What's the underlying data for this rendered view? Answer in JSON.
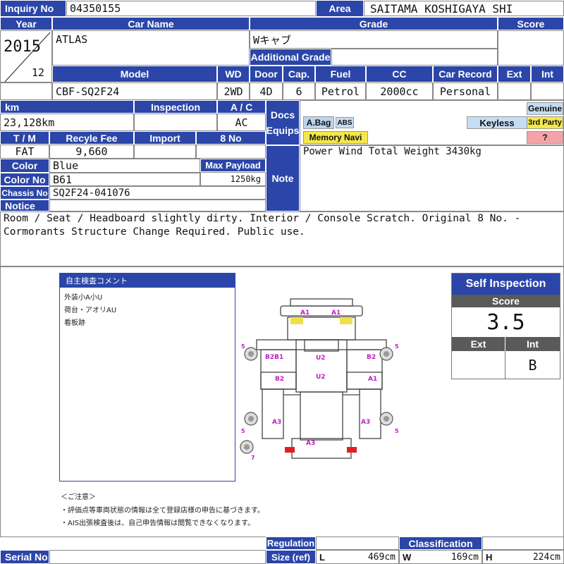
{
  "top": {
    "inquiry_label": "Inquiry No",
    "inquiry_value": "04350155",
    "area_label": "Area",
    "area_value": "SAITAMA KOSHIGAYA SHI"
  },
  "headers": {
    "year": "Year",
    "car_name": "Car Name",
    "grade": "Grade",
    "score": "Score",
    "additional_grade": "Additional Grade",
    "model": "Model",
    "wd": "WD",
    "door": "Door",
    "cap": "Cap.",
    "fuel": "Fuel",
    "cc": "CC",
    "car_record": "Car Record",
    "ext": "Ext",
    "int": "Int",
    "km": "km",
    "inspection": "Inspection",
    "ac": "A / C",
    "docs_equips": "Docs Equips",
    "tm": "T / M",
    "recycle_fee": "Recyle Fee",
    "import": "Import",
    "eight_no": "8 No",
    "color": "Color",
    "max_payload": "Max Payload",
    "color_no": "Color No",
    "chassis_no": "Chassis No",
    "note": "Note",
    "notice": "Notice"
  },
  "vehicle": {
    "year": "2015",
    "month": "12",
    "car_name": "ATLAS",
    "grade": "Wキャブ",
    "additional_grade": "",
    "model": "CBF-SQ2F24",
    "wd": "2WD",
    "door": "4D",
    "cap": "6",
    "fuel": "Petrol",
    "cc": "2000cc",
    "car_record": "Personal",
    "ext": "",
    "int": "",
    "km": "23,128km",
    "inspection": "",
    "ac": "AC",
    "tm": "FAT",
    "recycle_fee": "9,660",
    "import": "",
    "eight_no": "",
    "color": "Blue",
    "max_payload": "1250kg",
    "color_no": "B61",
    "chassis_no": "SQ2F24-041076"
  },
  "equips": {
    "abag": "A.Bag",
    "abs": "ABS",
    "memory_navi": "Memory Navi",
    "keyless": "Keyless",
    "genuine": "Genuine",
    "third_party": "3rd Party",
    "question": "?"
  },
  "note_text": "Power Wind Total Weight 3430kg",
  "notice_text": "Room / Seat / Headboard slightly dirty. Interior / Console Scratch. Original 8 No. - Cormorants Structure Change Required. Public use.",
  "comment_box": {
    "title": "自主検査コメント",
    "lines": [
      "外装小A小U",
      "荷台・アオリAU",
      "看板跡"
    ]
  },
  "diagram": {
    "labels": [
      "A1",
      "A1",
      "B2B1",
      "U2",
      "B2",
      "B2",
      "U2",
      "A1",
      "A3",
      "A3",
      "A3"
    ],
    "tire_numbers": [
      "5",
      "5",
      "5",
      "5",
      "7"
    ]
  },
  "self_inspection": {
    "title": "Self Inspection",
    "score_label": "Score",
    "score_value": "3.5",
    "ext_label": "Ext",
    "int_label": "Int",
    "ext_value": "",
    "int_value": "B"
  },
  "caution": {
    "title": "＜ご注意＞",
    "line1": "・評価点等車両状態の情報は全て登録店様の申告に基づきます。",
    "line2": "・AIS出張検査後は、自己申告情報は閲覧できなくなります。"
  },
  "bottom": {
    "serial_no": "Serial No",
    "regulation": "Regulation",
    "size_ref": "Size (ref)",
    "classification": "Classification",
    "l_label": "L",
    "l_value": "469cm",
    "w_label": "W",
    "w_value": "169cm",
    "h_label": "H",
    "h_value": "224cm"
  },
  "colors": {
    "header_blue": "#2b46a8",
    "abag_bg": "#bcd3ee",
    "navi_yellow": "#f4e84a",
    "genuine_bg": "#c6dcf2",
    "third_party_yellow": "#f4e84a",
    "question_pink": "#f3a3a8",
    "damage_yellow": "#efe04a",
    "damage_red": "#e02020",
    "label_magenta": "#c020c0"
  }
}
